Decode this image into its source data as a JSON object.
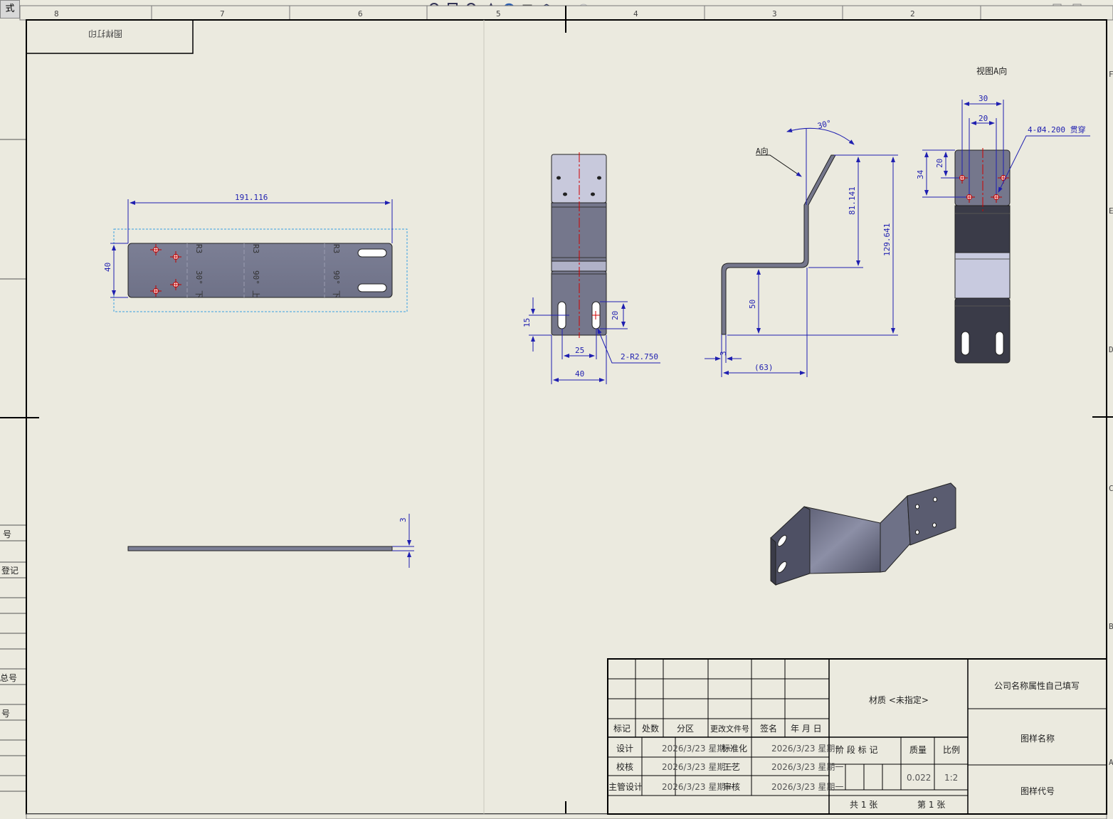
{
  "mode_tab": "式",
  "ruler": {
    "top": [
      "8",
      "7",
      "6",
      "5",
      "4",
      "3",
      "2"
    ],
    "right": [
      "F",
      "E",
      "D",
      "C",
      "B",
      "A"
    ]
  },
  "left_strip": {
    "labels": [
      "号",
      "登记",
      "总号",
      "号"
    ]
  },
  "view_label_box": "图样打印",
  "views": {
    "flat_pattern": {
      "length_dim": "191.116",
      "width_dim": "40",
      "bend_notes": [
        "R3",
        "R3",
        "R3"
      ],
      "bend_angles": [
        "30°",
        "90°",
        "90°"
      ],
      "bend_dirs": [
        "下",
        "上",
        "下"
      ]
    },
    "edge_view": {
      "thickness_dim": "3"
    },
    "front_view": {
      "dim_25": "25",
      "dim_40": "40",
      "dim_15": "15",
      "dim_20": "20",
      "slot_note": "2-R2.750"
    },
    "side_view": {
      "angle": "30°",
      "arrow_label": "A向",
      "dim_81": "81.141",
      "dim_129": "129.641",
      "dim_50": "50",
      "dim_3": "3",
      "dim_63": "(63)"
    },
    "view_a": {
      "title": "视图A向",
      "dim_30": "30",
      "dim_20_top": "20",
      "dim_20_side": "20",
      "dim_34": "34",
      "hole_note": "4-Ø4.200 贯穿"
    }
  },
  "title_block": {
    "material": "材质 <未指定>",
    "company": "公司名称属性自己填写",
    "drawing_name": "图样名称",
    "drawing_code": "图样代号",
    "headers": [
      "标记",
      "处数",
      "分区",
      "更改文件号",
      "签名",
      "年 月 日"
    ],
    "rows": [
      {
        "role": "设计",
        "date": "2026/3/23 星期一",
        "role2": "标准化",
        "date2": "2026/3/23 星期一"
      },
      {
        "role": "校核",
        "date": "2026/3/23 星期一",
        "role2": "工艺",
        "date2": "2026/3/23 星期一"
      },
      {
        "role": "主管设计",
        "date": "2026/3/23 星期一",
        "role2": "审核",
        "date2": "2026/3/23 星期一"
      }
    ],
    "stage_label": "阶 段 标 记",
    "mass_label": "质量",
    "scale_label": "比例",
    "mass_value": "0.022",
    "scale_value": "1:2",
    "total_sheets": "共 1 张",
    "sheet_no": "第 1 张"
  },
  "colors": {
    "paper": "#ebeadf",
    "part_fill": "#7e8096",
    "dim": "#1f1fb0",
    "centerline": "#d00000"
  }
}
